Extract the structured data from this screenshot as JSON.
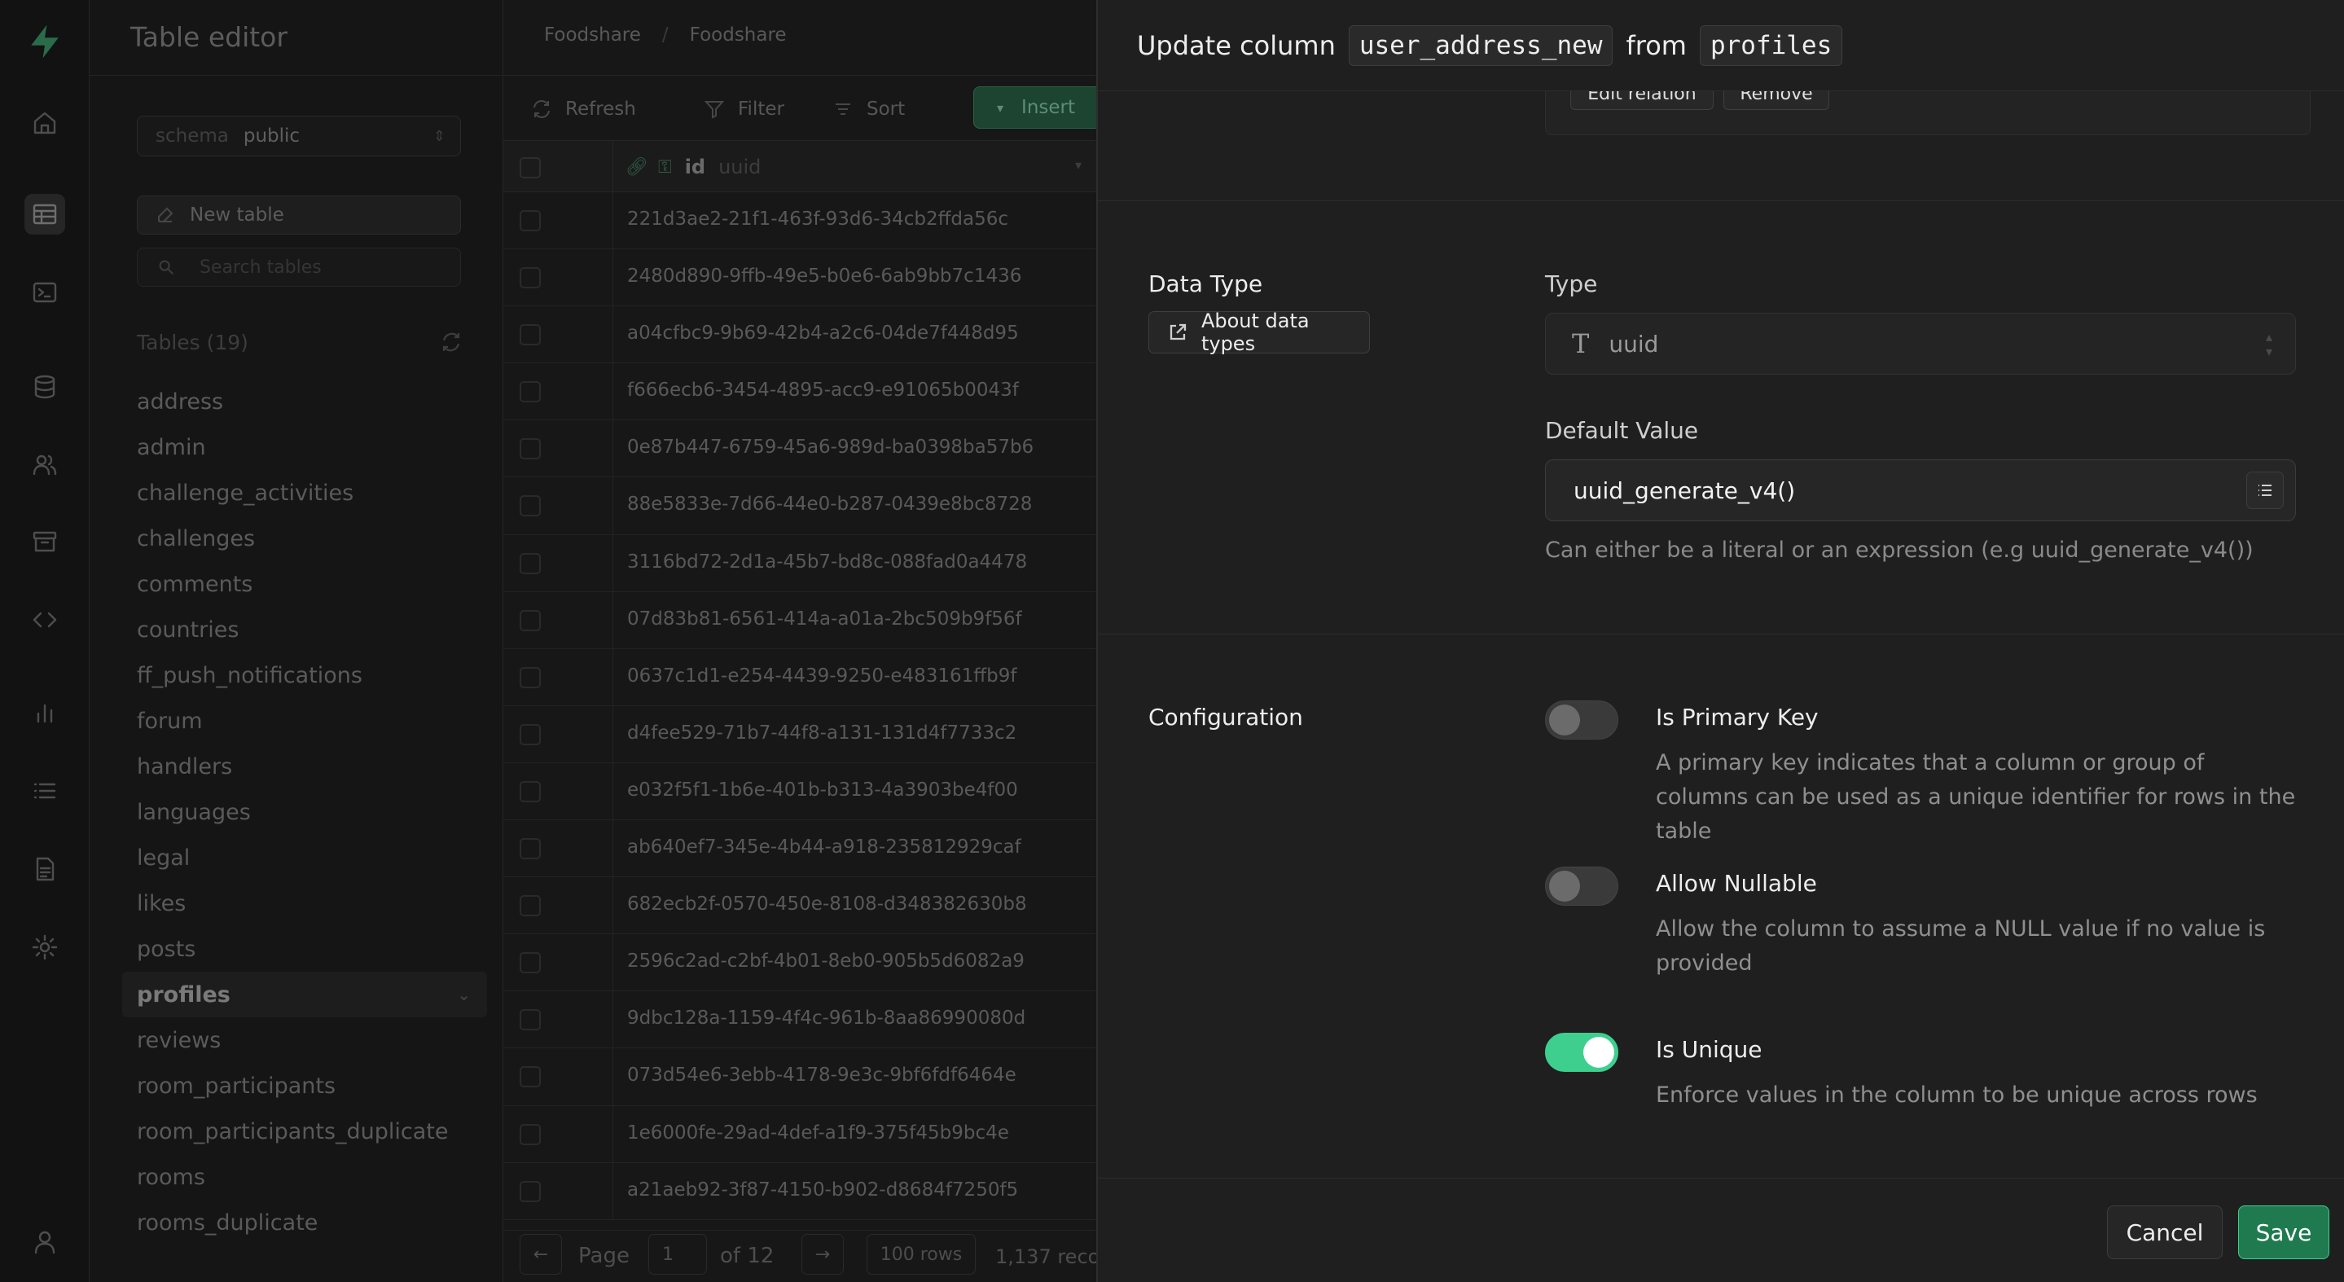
{
  "app": {
    "section_title": "Table editor",
    "accent_color": "#3ecf8e"
  },
  "rail_icons": [
    "home-icon",
    "table-icon",
    "terminal-icon",
    "database-icon",
    "users-icon",
    "archive-icon",
    "code-icon",
    "chart-icon",
    "list-icon",
    "document-icon",
    "settings-icon",
    "user-icon"
  ],
  "sidebar": {
    "schema_label": "schema",
    "schema_value": "public",
    "new_table_label": "New table",
    "search_placeholder": "Search tables",
    "tables_header": "Tables (19)",
    "tables": [
      "address",
      "admin",
      "challenge_activities",
      "challenges",
      "comments",
      "countries",
      "ff_push_notifications",
      "forum",
      "handlers",
      "languages",
      "legal",
      "likes",
      "posts",
      "profiles",
      "reviews",
      "room_participants",
      "room_participants_duplicate",
      "rooms",
      "rooms_duplicate"
    ],
    "selected_table": "profiles"
  },
  "grid": {
    "breadcrumb": [
      "Foodshare",
      "Foodshare"
    ],
    "toolbar": {
      "refresh_label": "Refresh",
      "filter_label": "Filter",
      "sort_label": "Sort",
      "insert_label": "Insert"
    },
    "column": {
      "name": "id",
      "type": "uuid"
    },
    "rows": [
      "221d3ae2-21f1-463f-93d6-34cb2ffda56c",
      "2480d890-9ffb-49e5-b0e6-6ab9bb7c1436",
      "a04cfbc9-9b69-42b4-a2c6-04de7f448d95",
      "f666ecb6-3454-4895-acc9-e91065b0043f",
      "0e87b447-6759-45a6-989d-ba0398ba57b6",
      "88e5833e-7d66-44e0-b287-0439e8bc8728",
      "3116bd72-2d1a-45b7-bd8c-088fad0a4478",
      "07d83b81-6561-414a-a01a-2bc509b9f56f",
      "0637c1d1-e254-4439-9250-e483161ffb9f",
      "d4fee529-71b7-44f8-a131-131d4f7733c2",
      "e032f5f1-1b6e-401b-b313-4a3903be4f00",
      "ab640ef7-345e-4b44-a918-235812929caf",
      "682ecb2f-0570-450e-8108-d348382630b8",
      "2596c2ad-c2bf-4b01-8eb0-905b5d6082a9",
      "9dbc128a-1159-4f4c-961b-8aa86990080d",
      "073d54e6-3ebb-4178-9e3c-9bf6fdf6464e",
      "1e6000fe-29ad-4def-a1f9-375f45b9bc4e",
      "a21aeb92-3f87-4150-b902-d8684f7250f5"
    ],
    "pager": {
      "page_label": "Page",
      "page_value": "1",
      "of_label": "of 12",
      "rows_label": "100 rows",
      "records_label": "1,137 reco"
    }
  },
  "panel": {
    "title_prefix": "Update column",
    "column_name": "user_address_new",
    "title_mid": "from",
    "table_name": "profiles",
    "relation": {
      "edit_label": "Edit relation",
      "remove_label": "Remove"
    },
    "data_type": {
      "section_label": "Data Type",
      "about_label": "About data types",
      "type_label": "Type",
      "type_value": "uuid",
      "default_label": "Default Value",
      "default_value": "uuid_generate_v4()",
      "help_text": "Can either be a literal or an expression (e.g uuid_generate_v4())"
    },
    "configuration": {
      "section_label": "Configuration",
      "options": [
        {
          "title": "Is Primary Key",
          "description": "A primary key indicates that a column or group of columns can be used as a unique identifier for rows in the table",
          "enabled": false
        },
        {
          "title": "Allow Nullable",
          "description": "Allow the column to assume a NULL value if no value is provided",
          "enabled": false
        },
        {
          "title": "Is Unique",
          "description": "Enforce values in the column to be unique across rows",
          "enabled": true
        }
      ]
    },
    "footer": {
      "cancel_label": "Cancel",
      "save_label": "Save"
    }
  }
}
